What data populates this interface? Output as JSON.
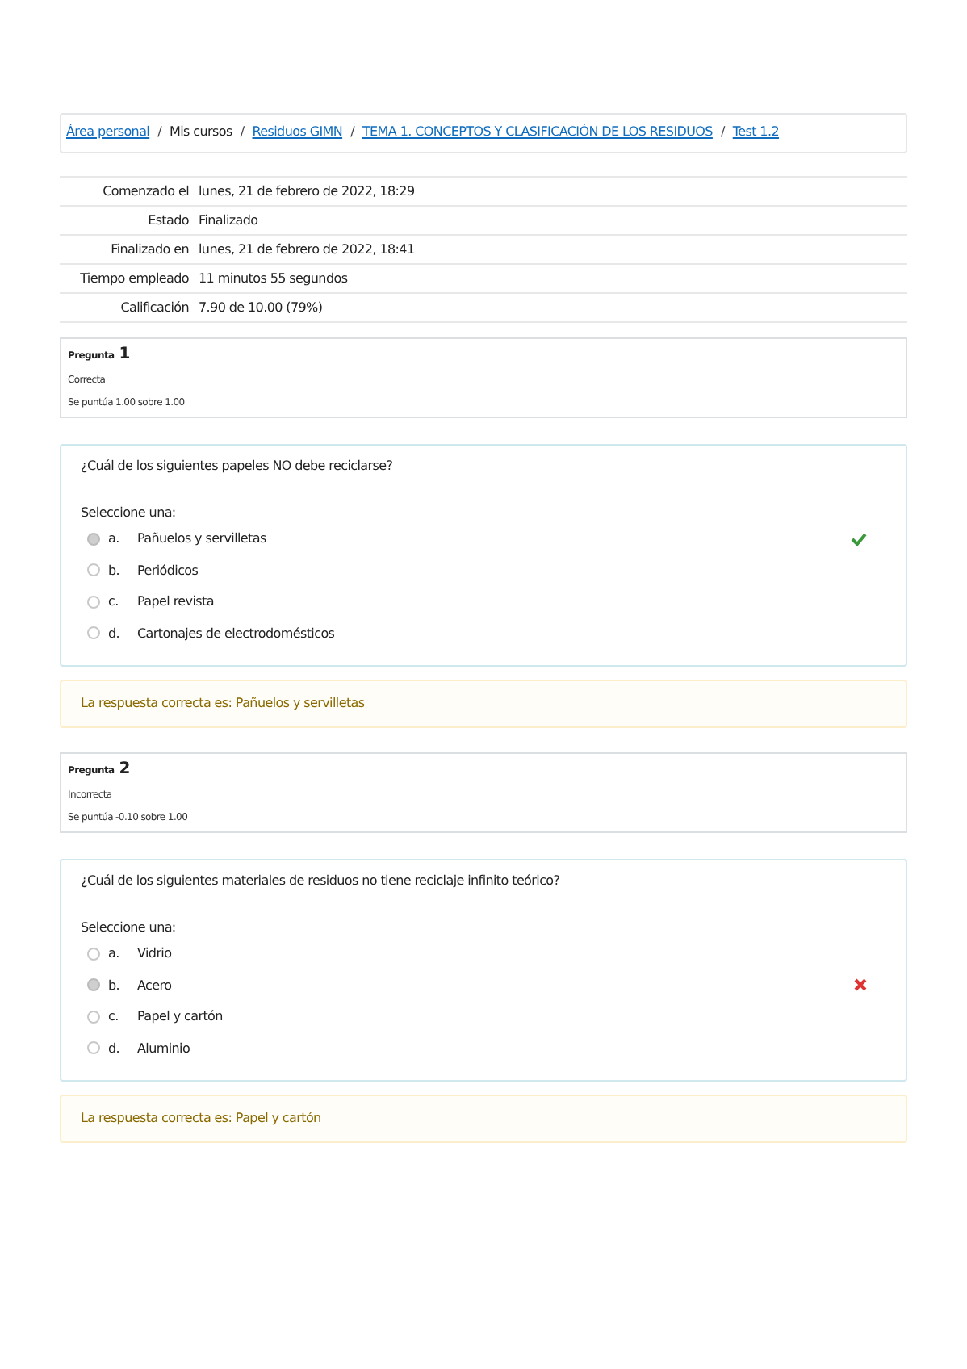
{
  "breadcrumb": [
    {
      "label": "Área personal",
      "kind": "link",
      "separator": "/"
    },
    {
      "label": "Mis cursos",
      "kind": "text",
      "separator": "/"
    },
    {
      "label": "Residuos GIMN",
      "kind": "link",
      "separator": "/"
    },
    {
      "label": "TEMA 1. CONCEPTOS Y CLASIFICACIÓN DE LOS RESIDUOS",
      "kind": "link",
      "separator": "/"
    },
    {
      "label": "Test 1.2",
      "kind": "link"
    }
  ],
  "summary": [
    {
      "label": "Comenzado el",
      "value": "lunes, 21 de febrero de 2022, 18:29"
    },
    {
      "label": "Estado",
      "value": "Finalizado"
    },
    {
      "label": "Finalizado en",
      "value": "lunes, 21 de febrero de 2022, 18:41"
    },
    {
      "label": "Tiempo empleado",
      "value": "11 minutos 55 segundos"
    },
    {
      "label": "Calificación",
      "value": "7.90 de 10.00 (79%)"
    }
  ],
  "questions": [
    {
      "label": "Pregunta",
      "number": "1",
      "status": "Correcta",
      "score": "Se puntúa 1.00 sobre 1.00",
      "kind": "correct",
      "text": "¿Cuál de los siguientes papeles NO debe reciclarse?",
      "prompt": "Seleccione una:",
      "options": [
        {
          "letter": "a.",
          "text": "Pañuelos y servilletas",
          "selected": true
        },
        {
          "letter": "b.",
          "text": "Periódicos",
          "selected": false
        },
        {
          "letter": "c.",
          "text": "Papel revista",
          "selected": false
        },
        {
          "letter": "d.",
          "text": "Cartonajes de electrodomésticos",
          "selected": false
        }
      ],
      "feedback": "La respuesta correcta es: Pañuelos y servilletas"
    },
    {
      "label": "Pregunta",
      "number": "2",
      "status": "Incorrecta",
      "score": "Se puntúa -0.10 sobre 1.00",
      "kind": "incorrect",
      "text": "¿Cuál de los siguientes materiales de residuos no tiene reciclaje infinito teórico?",
      "prompt": "Seleccione una:",
      "options": [
        {
          "letter": "a.",
          "text": "Vidrio",
          "selected": false
        },
        {
          "letter": "b.",
          "text": "Acero",
          "selected": true
        },
        {
          "letter": "c.",
          "text": "Papel y cartón",
          "selected": false
        },
        {
          "letter": "d.",
          "text": "Aluminio",
          "selected": false
        }
      ],
      "feedback": "La respuesta correcta es: Papel y cartón"
    }
  ]
}
